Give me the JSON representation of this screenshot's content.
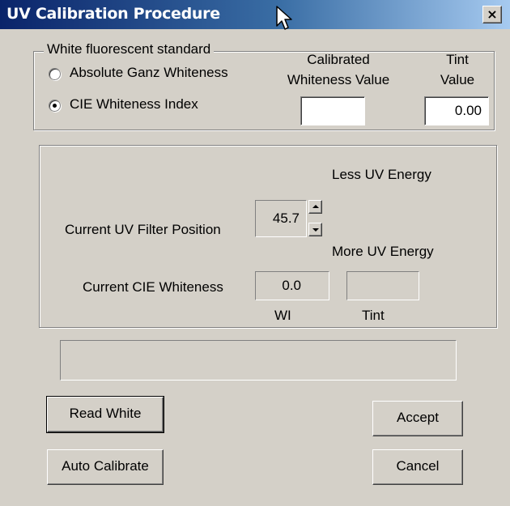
{
  "window": {
    "title": "UV Calibration Procedure",
    "close_glyph": "×",
    "cursor_icon": "arrow-pointer-icon"
  },
  "white_standard": {
    "legend": "White fluorescent standard",
    "options": [
      {
        "label": "Absolute Ganz Whiteness",
        "selected": false
      },
      {
        "label": "CIE Whiteness Index",
        "selected": true
      }
    ],
    "calibrated_header_line1": "Calibrated",
    "calibrated_header_line2": "Whiteness Value",
    "calibrated_value": "",
    "tint_header_line1": "Tint",
    "tint_header_line2": "Value",
    "tint_value": "0.00"
  },
  "uv_filter": {
    "less_label": "Less UV Energy",
    "more_label": "More UV Energy",
    "position_label": "Current UV Filter Position",
    "position_value": "45.7",
    "cie_label": "Current CIE Whiteness",
    "wi_value": "0.0",
    "tint_value": "",
    "wi_caption": "WI",
    "tint_caption": "Tint"
  },
  "status_message": "",
  "buttons": {
    "read_white": "Read White",
    "auto_calibrate": "Auto Calibrate",
    "accept": "Accept",
    "cancel": "Cancel"
  }
}
